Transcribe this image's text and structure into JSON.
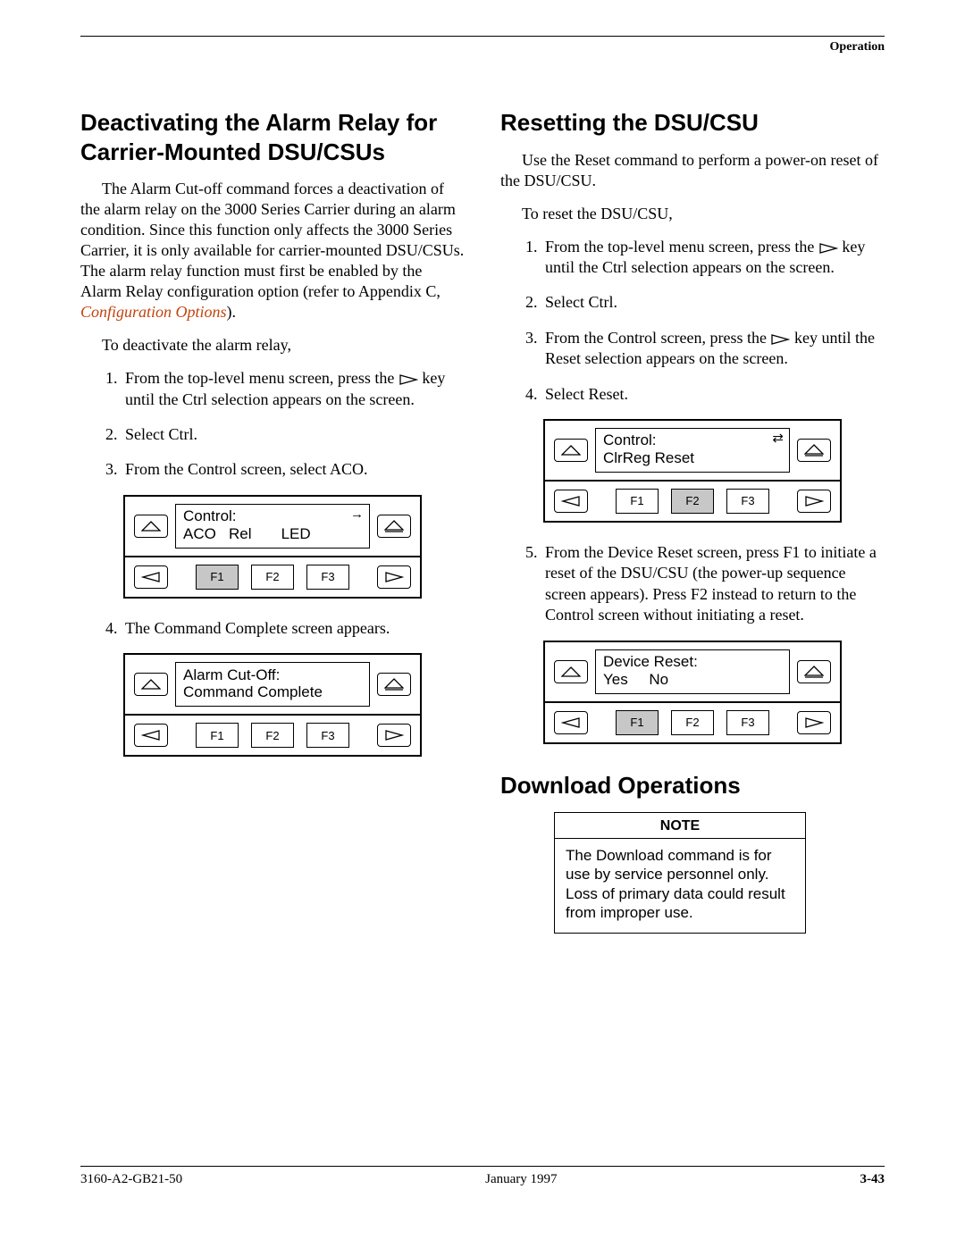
{
  "running_head": "Operation",
  "left": {
    "heading": "Deactivating the Alarm Relay for Carrier-Mounted DSU/CSUs",
    "para": "The Alarm Cut-off command forces a deactivation of the alarm relay on the 3000 Series Carrier during an alarm condition. Since this function only affects the 3000 Series Carrier, it is only available for carrier-mounted DSU/CSUs. The alarm relay function must first be enabled by the Alarm Relay configuration option (refer to Appendix C, ",
    "cfg_link": "Configuration Options",
    "para_end": ").",
    "lead": "To deactivate the alarm relay,",
    "steps": {
      "s1a": "From the top-level menu screen, press the ",
      "s1b": " key until the Ctrl selection appears on the screen.",
      "s2": "Select Ctrl.",
      "s3": "From the Control screen, select ACO.",
      "s4": "The Command Complete screen appears."
    },
    "panel1": {
      "line1": "Control:",
      "line2": "ACO   Rel       LED",
      "corner": "→",
      "f1": "F1",
      "f2": "F2",
      "f3": "F3"
    },
    "panel2": {
      "line1": "Alarm Cut-Off:",
      "line2": "Command Complete",
      "f1": "F1",
      "f2": "F2",
      "f3": "F3"
    }
  },
  "right": {
    "heading1": "Resetting the DSU/CSU",
    "para1": "Use the Reset command to perform a power-on reset of the DSU/CSU.",
    "lead": "To reset the DSU/CSU,",
    "steps": {
      "s1a": "From the top-level menu screen, press the ",
      "s1b": " key until the Ctrl selection appears on the screen.",
      "s2": "Select Ctrl.",
      "s3a": "From the Control screen, press the ",
      "s3b": " key until the Reset selection appears on the screen.",
      "s4": "Select Reset.",
      "s5": "From the Device Reset screen, press F1 to initiate a reset of the DSU/CSU (the power-up sequence screen appears). Press F2 instead to return to the Control screen without initiating a reset."
    },
    "panel1": {
      "line1": "Control:",
      "line2": "ClrReg Reset",
      "corner": "⇄",
      "f1": "F1",
      "f2": "F2",
      "f3": "F3"
    },
    "panel2": {
      "line1": "Device Reset:",
      "line2": "Yes     No",
      "f1": "F1",
      "f2": "F2",
      "f3": "F3"
    },
    "heading2": "Download Operations",
    "note_title": "NOTE",
    "note_body": "The Download command is for use by service personnel only. Loss of primary data could result from improper use."
  },
  "footer": {
    "left": "3160-A2-GB21-50",
    "center": "January 1997",
    "right": "3-43"
  }
}
